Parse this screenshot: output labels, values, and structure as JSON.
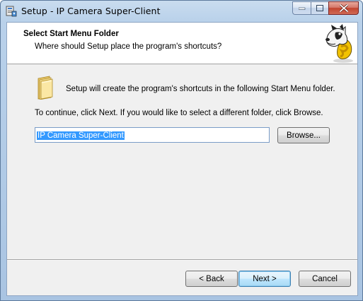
{
  "window": {
    "title": "Setup - IP Camera Super-Client"
  },
  "caption_buttons": {
    "minimize_icon": "minimize-icon",
    "maximize_icon": "maximize-icon",
    "close_icon": "close-icon"
  },
  "header": {
    "title": "Select Start Menu Folder",
    "subtitle": "Where should Setup place the program's shortcuts?"
  },
  "body": {
    "info_text": "Setup will create the program's shortcuts in the following Start Menu folder.",
    "continue_text": "To continue, click Next. If you would like to select a different folder, click Browse.",
    "folder_value": "IP Camera Super-Client",
    "browse_label": "Browse..."
  },
  "footer": {
    "back_label": "< Back",
    "next_label": "Next >",
    "cancel_label": "Cancel"
  },
  "colors": {
    "selection": "#3399ff",
    "window_frame": "#b9d1ea",
    "close_button": "#c2442f"
  }
}
